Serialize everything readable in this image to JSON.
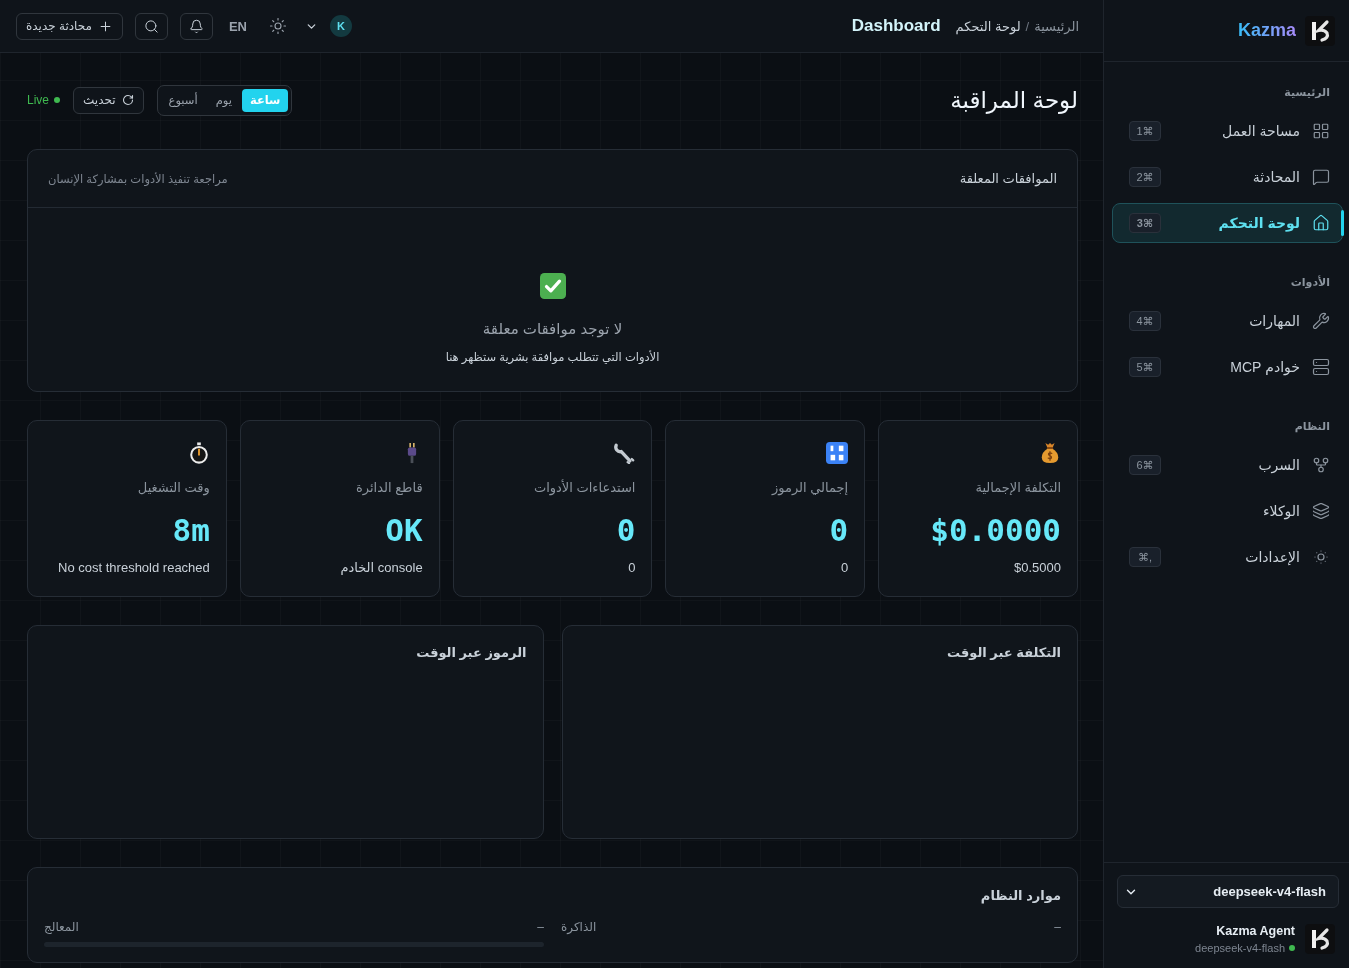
{
  "sidebar": {
    "brand": "Kazma",
    "sections": [
      {
        "title": "الرئيسية",
        "items": [
          {
            "label": "مساحة العمل",
            "shortcut": "1⌘",
            "selected": false
          },
          {
            "label": "المحادثة",
            "shortcut": "2⌘",
            "selected": false
          },
          {
            "label": "لوحة التحكم",
            "shortcut": "3⌘",
            "selected": true
          }
        ]
      },
      {
        "title": "الأدوات",
        "items": [
          {
            "label": "المهارات",
            "shortcut": "4⌘",
            "selected": false
          },
          {
            "label": "خوادم MCP",
            "shortcut": "5⌘",
            "selected": false
          }
        ]
      },
      {
        "title": "النظام",
        "items": [
          {
            "label": "السرب",
            "shortcut": "6⌘",
            "selected": false
          },
          {
            "label": "الوكلاء",
            "selected": false
          },
          {
            "label": "الإعدادات",
            "shortcut": "⌘,",
            "selected": false
          }
        ]
      }
    ],
    "model_select": {
      "value": "deepseek-v4-flash"
    },
    "agent": {
      "name": "Kazma Agent",
      "model": "deepseek-v4-flash",
      "online": true
    }
  },
  "topbar": {
    "breadcrumb": [
      "الرئيسية",
      "لوحة التحكم"
    ],
    "separator": "/",
    "title": "Dashboard",
    "avatar": "K",
    "language": "EN",
    "new_chat_button": "محادثة جديدة"
  },
  "header": {
    "title": "لوحة المراقبة",
    "ranges": [
      {
        "label": "ساعة",
        "selected": true
      },
      {
        "label": "يوم",
        "selected": false
      },
      {
        "label": "أسبوع",
        "selected": false
      }
    ],
    "refresh_button": "تحديث",
    "live": {
      "label": "Live",
      "on": true
    }
  },
  "approvals": {
    "title": "الموافقات المعلقة",
    "subtitle": "مراجعة تنفيذ الأدوات بمشاركة الإنسان",
    "empty_title": "لا توجد موافقات معلقة",
    "empty_text": "الأدوات التي تتطلب موافقة بشرية ستظهر هنا"
  },
  "stats": [
    {
      "label": "التكلفة الإجمالية",
      "value": "$0.0000",
      "sub": "$0.5000"
    },
    {
      "label": "إجمالي الرموز",
      "value": "0",
      "sub": "0"
    },
    {
      "label": "استدعاءات الأدوات",
      "value": "0",
      "sub": "0"
    },
    {
      "label": "قاطع الدائرة",
      "value": "OK",
      "sub": "console الخادم"
    },
    {
      "label": "وقت التشغيل",
      "value": "8m",
      "sub": "No cost threshold reached"
    }
  ],
  "charts": [
    {
      "title": "التكلفة عبر الوقت"
    },
    {
      "title": "الرموز عبر الوقت"
    }
  ],
  "resources": {
    "title": "موارد النظام",
    "items": [
      {
        "kind": "text",
        "label": "الذاكرة",
        "value": "–"
      },
      {
        "kind": "meter",
        "label": "المعالج",
        "value": "–"
      }
    ]
  }
}
